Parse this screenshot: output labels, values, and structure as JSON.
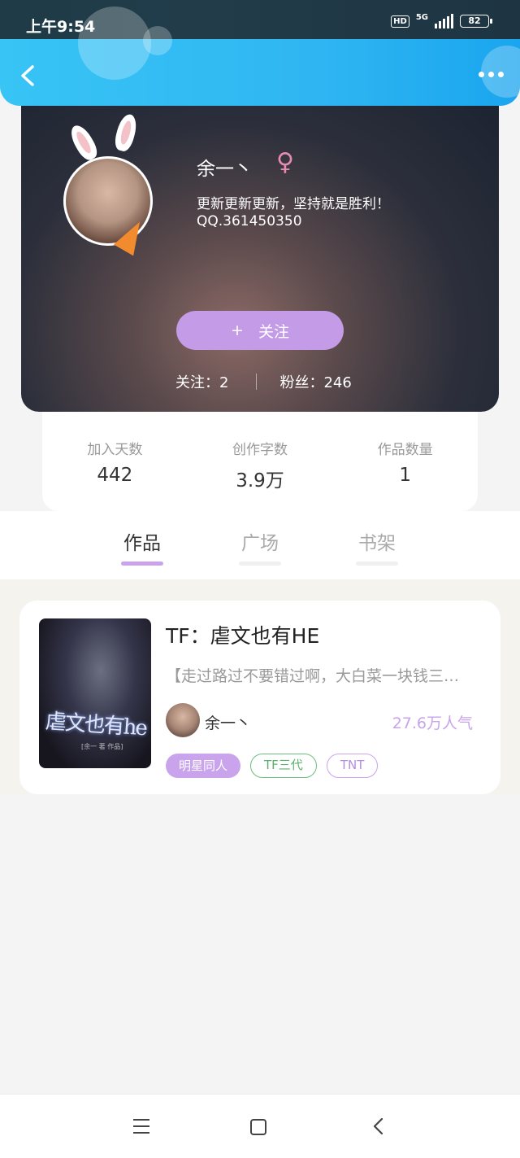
{
  "status_bar": {
    "time": "上午9:54",
    "hd": "HD",
    "network": "5G",
    "battery": "82"
  },
  "profile": {
    "name": "余一丶",
    "gender_symbol": "♀",
    "bio": "更新更新更新，坚持就是胜利！",
    "qq": "QQ.361450350",
    "follow_button": {
      "icon": "+",
      "label": "关注"
    },
    "following": "关注：2",
    "followers": "粉丝：246"
  },
  "stats": [
    {
      "label": "加入天数",
      "value": "442"
    },
    {
      "label": "创作字数",
      "value": "3.9万"
    },
    {
      "label": "作品数量",
      "value": "1"
    }
  ],
  "tabs": [
    {
      "label": "作品",
      "active": true
    },
    {
      "label": "广场",
      "active": false
    },
    {
      "label": "书架",
      "active": false
    }
  ],
  "book": {
    "title": "TF：虐文也有HE",
    "description": "【走过路过不要错过啊，大白菜一块钱三…",
    "author": "余一丶",
    "popularity": "27.6万人气",
    "cover_title": "虐文也有he",
    "cover_subtitle": "[余一 著 作品]",
    "tags": [
      "明星同人",
      "TF三代",
      "TNT"
    ]
  },
  "colors": {
    "accent": "#c9a3ec",
    "nav_blue": "#2fb6f2",
    "green_tag": "#6bbf7e"
  }
}
